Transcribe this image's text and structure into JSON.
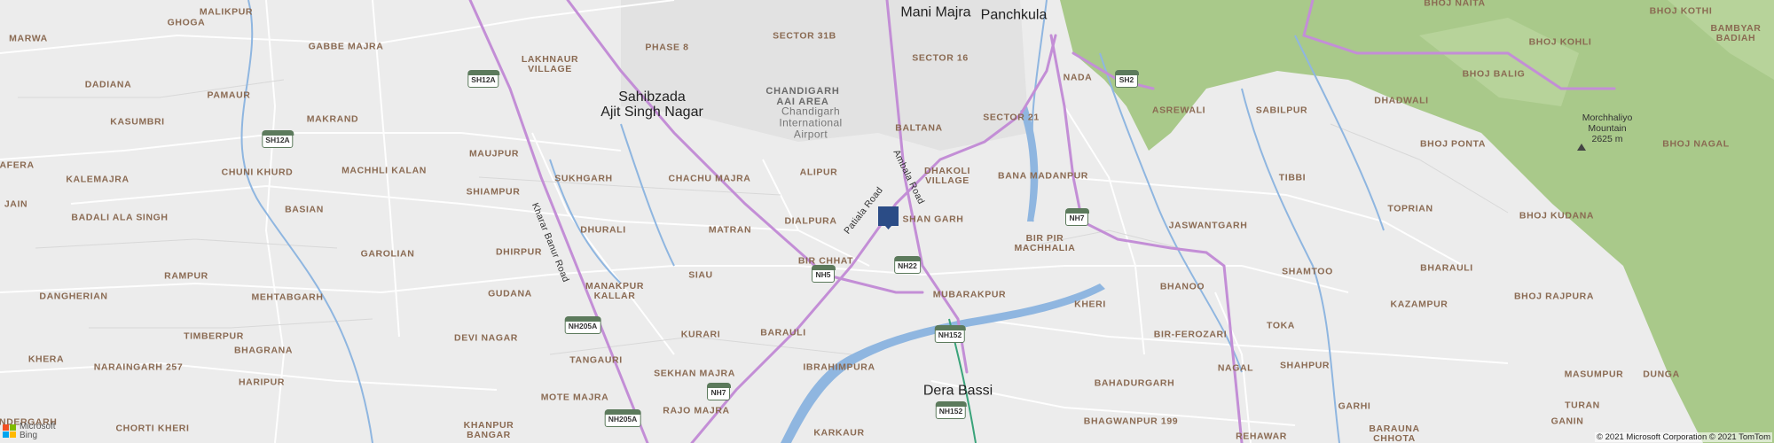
{
  "map": {
    "colors": {
      "background": "#ececec",
      "forest": "#a9c98a",
      "water": "#8fb6e0",
      "highway": "#c38ed6",
      "road": "#ffffff",
      "pin": "#2b4c86"
    },
    "cities": [
      "Mani Majra",
      "Panchkula",
      "Sahibzada\nAjit Singh Nagar",
      "Dera Bassi"
    ],
    "places": [
      "MALIKPUR",
      "GHOGA",
      "MARWA",
      "GABBE MAJRA",
      "LAKHNAUR\nVILLAGE",
      "PHASE 8",
      "SECTOR 31B",
      "SECTOR 16",
      "DADIANA",
      "PAMAUR",
      "KASUMBRI",
      "MAKRAND",
      "MAUJPUR",
      "DAFERA",
      "KALEMAJRA",
      "CHUNI KHURD",
      "MACHHLI KALAN",
      "JAIN",
      "SHIAMPUR",
      "BASIAN",
      "BADALI ALA SINGH",
      "SUKHGARH",
      "CHACHU MAJRA",
      "ALIPUR",
      "BALTANA",
      "DHAKOLI\nVILLAGE",
      "SECTOR 21",
      "BANA MADANPUR",
      "DIALPURA",
      "SHAN GARH",
      "DHURALI",
      "MATRAN",
      "DHIRPUR",
      "GAROLIAN",
      "RAMPUR",
      "SIAU",
      "BIR CHHAT",
      "DANGHERIAN",
      "MEHTABGARH",
      "GUDANA",
      "MANAKPUR\nKALLAR",
      "KURARI",
      "BARAULI",
      "TIMBERPUR",
      "DEVI NAGAR",
      "BHAGRANA",
      "TANGAURI",
      "KHERA",
      "NARAINGARH 257",
      "SEKHAN MAJRA",
      "IBRAHIMPURA",
      "HARIPUR",
      "MOTE MAJRA",
      "RAJO MAJRA",
      "INDERGARH",
      "CHORTI KHERI",
      "KHANPUR\nBANGAR",
      "KARKAUR",
      "BIR PIR\nMACHHALIA",
      "MUBARAKPUR",
      "KHERI",
      "BIR-FEROZARI",
      "NADA",
      "ASREWALI",
      "SABILPUR",
      "DHADWALI",
      "TIBBI",
      "JASWANTGARH",
      "TOPRIAN",
      "SHAMTOO",
      "BHARAULI",
      "BHANOO",
      "KAZAMPUR",
      "TOKA",
      "NAGAL",
      "BAHADURGARH",
      "BHAGWANPUR 199",
      "SHAHPUR",
      "GARHI",
      "BARAUNA\nCHHOTA",
      "REHAWAR",
      "MASUMPUR",
      "TURAN",
      "GANIN",
      "DUNGA",
      "BHOJ NAITA",
      "BHOJ KOTHI",
      "BAMBYAR\nBADIAH",
      "BHOJ KOHLI",
      "BHOJ BALIG",
      "BHOJ PONTA",
      "BHOJ NAGAL",
      "BHOJ KUDANA",
      "BHOJ RAJPURA"
    ],
    "areas": [
      "CHANDIGARH\nAAI AREA"
    ],
    "airport": "Chandigarh\nInternational\nAirport",
    "mountain": "Morchhaliyo\nMountain\n2625 m",
    "road_names": [
      "Patiala Road",
      "Ambala Road",
      "Kharar Banur Road"
    ],
    "shields": [
      "SH12A",
      "SH12A",
      "NH205A",
      "NH205A",
      "NH5",
      "NH22",
      "NH152",
      "NH152",
      "NH7",
      "NH7",
      "SH2"
    ],
    "brand": {
      "line1": "Microsoft",
      "line2": "Bing"
    },
    "copyright": "© 2021 Microsoft Corporation © 2021 TomTom"
  }
}
